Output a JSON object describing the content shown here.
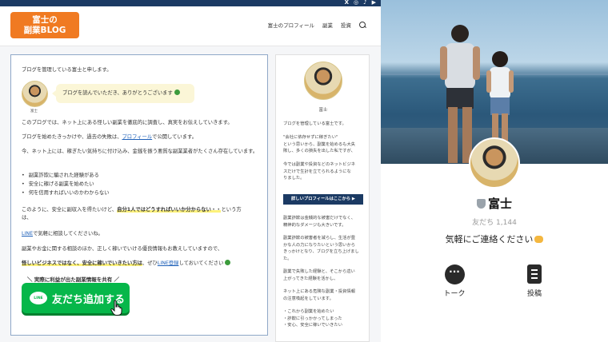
{
  "blog": {
    "topbar": {
      "social": [
        "X",
        "◎",
        "♪",
        "▶"
      ]
    },
    "logo": {
      "line1": "富士の",
      "line2": "副業BLOG"
    },
    "nav": {
      "items": [
        "富士のプロフィール",
        "副業",
        "投資"
      ]
    },
    "main": {
      "intro": "ブログを管理している富士と申します。",
      "author_name": "富士",
      "bubble": "ブログを読んでいただき、ありがとうございます",
      "p1": "このブログでは、ネット上にある怪しい副業を徹底的に調査し、真実をお伝えしていきます。",
      "p2_pre": "ブログを始めたきっかけや、過去の失敗は、",
      "p2_link": "プロフィール",
      "p2_post": "で公開しています。",
      "p3": "今、ネット上には、稼ぎたい気持ちに付け込み、金銭を振う悪質な副業業者がたくさん存在しています。",
      "list": [
        "副業詐欺に騙された経験がある",
        "安全に稼げる副業を始めたい",
        "何を信用すればいいのかわからない"
      ],
      "p4_pre": "このように、安全に副収入を得たいけど、",
      "p4_hl": "自分1人ではどうすればいいか分からない・・",
      "p4_post": "という方",
      "p4_cont": "は、",
      "p5_link": "LINE",
      "p5_post": "で気軽に相談してくださいね。",
      "p6": "副業やお金に関する相談のほか、正しく稼いでいける優良情報もお教えしていますので、",
      "p7_hl": "怪しいビジネスではなく、安全に稼いでいきたい方は",
      "p7_mid": "、ぜひ",
      "p7_link": "LINE登録",
      "p7_post": "しておいてください",
      "cta_caption": "＼ 実際に利益が出た副業情報を共有 ／",
      "line_icon": "LINE",
      "line_button": "友だち追加する"
    },
    "sidebar": {
      "name": "富士",
      "lines": [
        "ブログを管理している富士です。",
        "",
        "\"会社に依存せずに稼ぎたい\"",
        "という思いから、副業を始めるも大失",
        "敗し、多くの損失を出した私ですが、",
        "",
        "今では副業や投資などのネットビジネ",
        "スだけで生計を立てられるようにな",
        "りました。"
      ],
      "profile_button": "詳しいプロフィールはここから ▶",
      "lines2": [
        "副業詐欺は金銭的な被害だけでなく、",
        "精神的なダメージも大きいです。",
        "",
        "副業詐欺の被害者を減らし、生活が豊",
        "かな人の力になりたいという思いから",
        "きっかけとなり、ブログを立ち上げまし",
        "た。",
        "",
        "副業で失敗した経験と、そこから這い",
        "上がってきた経験を活かし、",
        "",
        "ネット上にある危険な副業・投資情報",
        "の注意喚起をしています。",
        "",
        "・これから副業を始めたい",
        "・詐欺に引っかかってしまった",
        "・安心、安全に稼いでいきたい"
      ]
    }
  },
  "line_profile": {
    "name": "富士",
    "friends": "友だち 1,144",
    "status": "気軽にご連絡ください",
    "actions": [
      {
        "label": "トーク",
        "icon": "chat-icon"
      },
      {
        "label": "投稿",
        "icon": "posts-icon"
      }
    ]
  }
}
